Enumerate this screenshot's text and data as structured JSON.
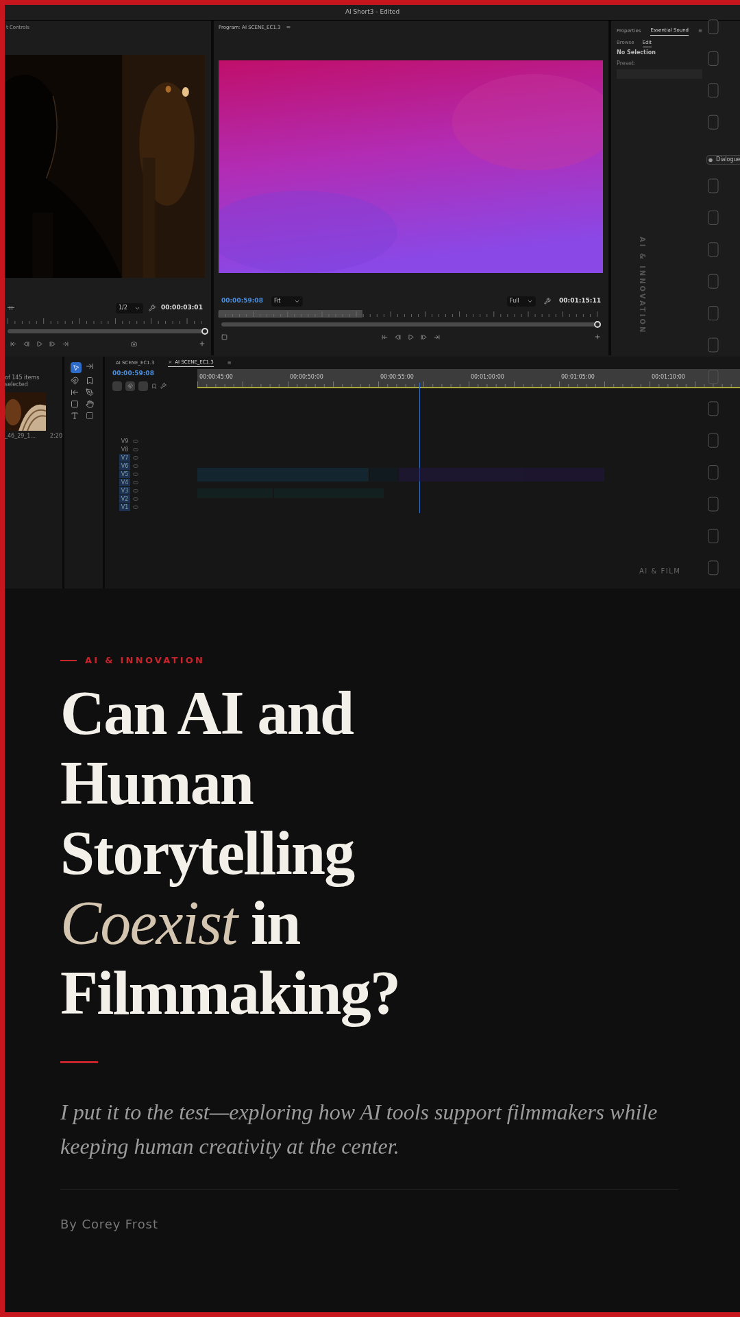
{
  "editor": {
    "title": "AI Short3 - Edited",
    "source_panel": {
      "title": "t Controls",
      "zoom": "1/2",
      "timecode": "00:00:03:01"
    },
    "program_panel": {
      "title": "Program: AI SCENE_EC1.3",
      "menu": "≡",
      "timecode": "00:00:59:08",
      "zoom": "Fit",
      "quality": "Full",
      "duration": "00:01:15:11"
    },
    "side_panel": {
      "tabs": [
        {
          "label": "Properties",
          "selected": false
        },
        {
          "label": "Essential Sound",
          "selected": true
        }
      ],
      "menu": "≡",
      "subtabs": [
        {
          "label": "Browse",
          "selected": false
        },
        {
          "label": "Edit",
          "selected": true
        }
      ],
      "status": "No Selection",
      "preset_label": "Preset:"
    },
    "project_panel": {
      "count": "of 145 items selected",
      "clip_name": "_46_29_1...",
      "clip_duration": "2:20"
    },
    "timeline": {
      "tabs": [
        {
          "label": "AI SCENE_EC1.3",
          "selected": false
        },
        {
          "label": "AI SCENE_EC1.3",
          "close": "×",
          "selected": true
        }
      ],
      "menu": "≡",
      "timecode": "00:00:59:08",
      "ruler": [
        "00:00:45:00",
        "00:00:50:00",
        "00:00:55:00",
        "00:01:00:00",
        "00:01:05:00",
        "00:01:10:00"
      ],
      "tracks": [
        {
          "label": "V9",
          "targeted": false
        },
        {
          "label": "V8",
          "targeted": false
        },
        {
          "label": "V7",
          "targeted": true
        },
        {
          "label": "V6",
          "targeted": true
        },
        {
          "label": "V5",
          "targeted": true
        },
        {
          "label": "V4",
          "targeted": true
        },
        {
          "label": "V3",
          "targeted": true
        },
        {
          "label": "V2",
          "targeted": true
        },
        {
          "label": "V1",
          "targeted": true
        }
      ]
    },
    "overlay": {
      "vertical_label": "AI & INNOVATION",
      "corner_label": "AI & FILM",
      "chip_label": "Dialogue"
    }
  },
  "hero": {
    "kicker": "AI & INNOVATION",
    "headline": [
      {
        "text": "Can AI and Human Storytelling",
        "kind": "plain"
      },
      {
        "text": "Coexist",
        "kind": "accent"
      },
      {
        "text": "in Filmmaking?",
        "kind": "plain"
      }
    ],
    "subtitle": "I put it to the test—exploring how AI tools support filmmakers while keeping human creativity at the center.",
    "byline": "By Corey Frost"
  }
}
